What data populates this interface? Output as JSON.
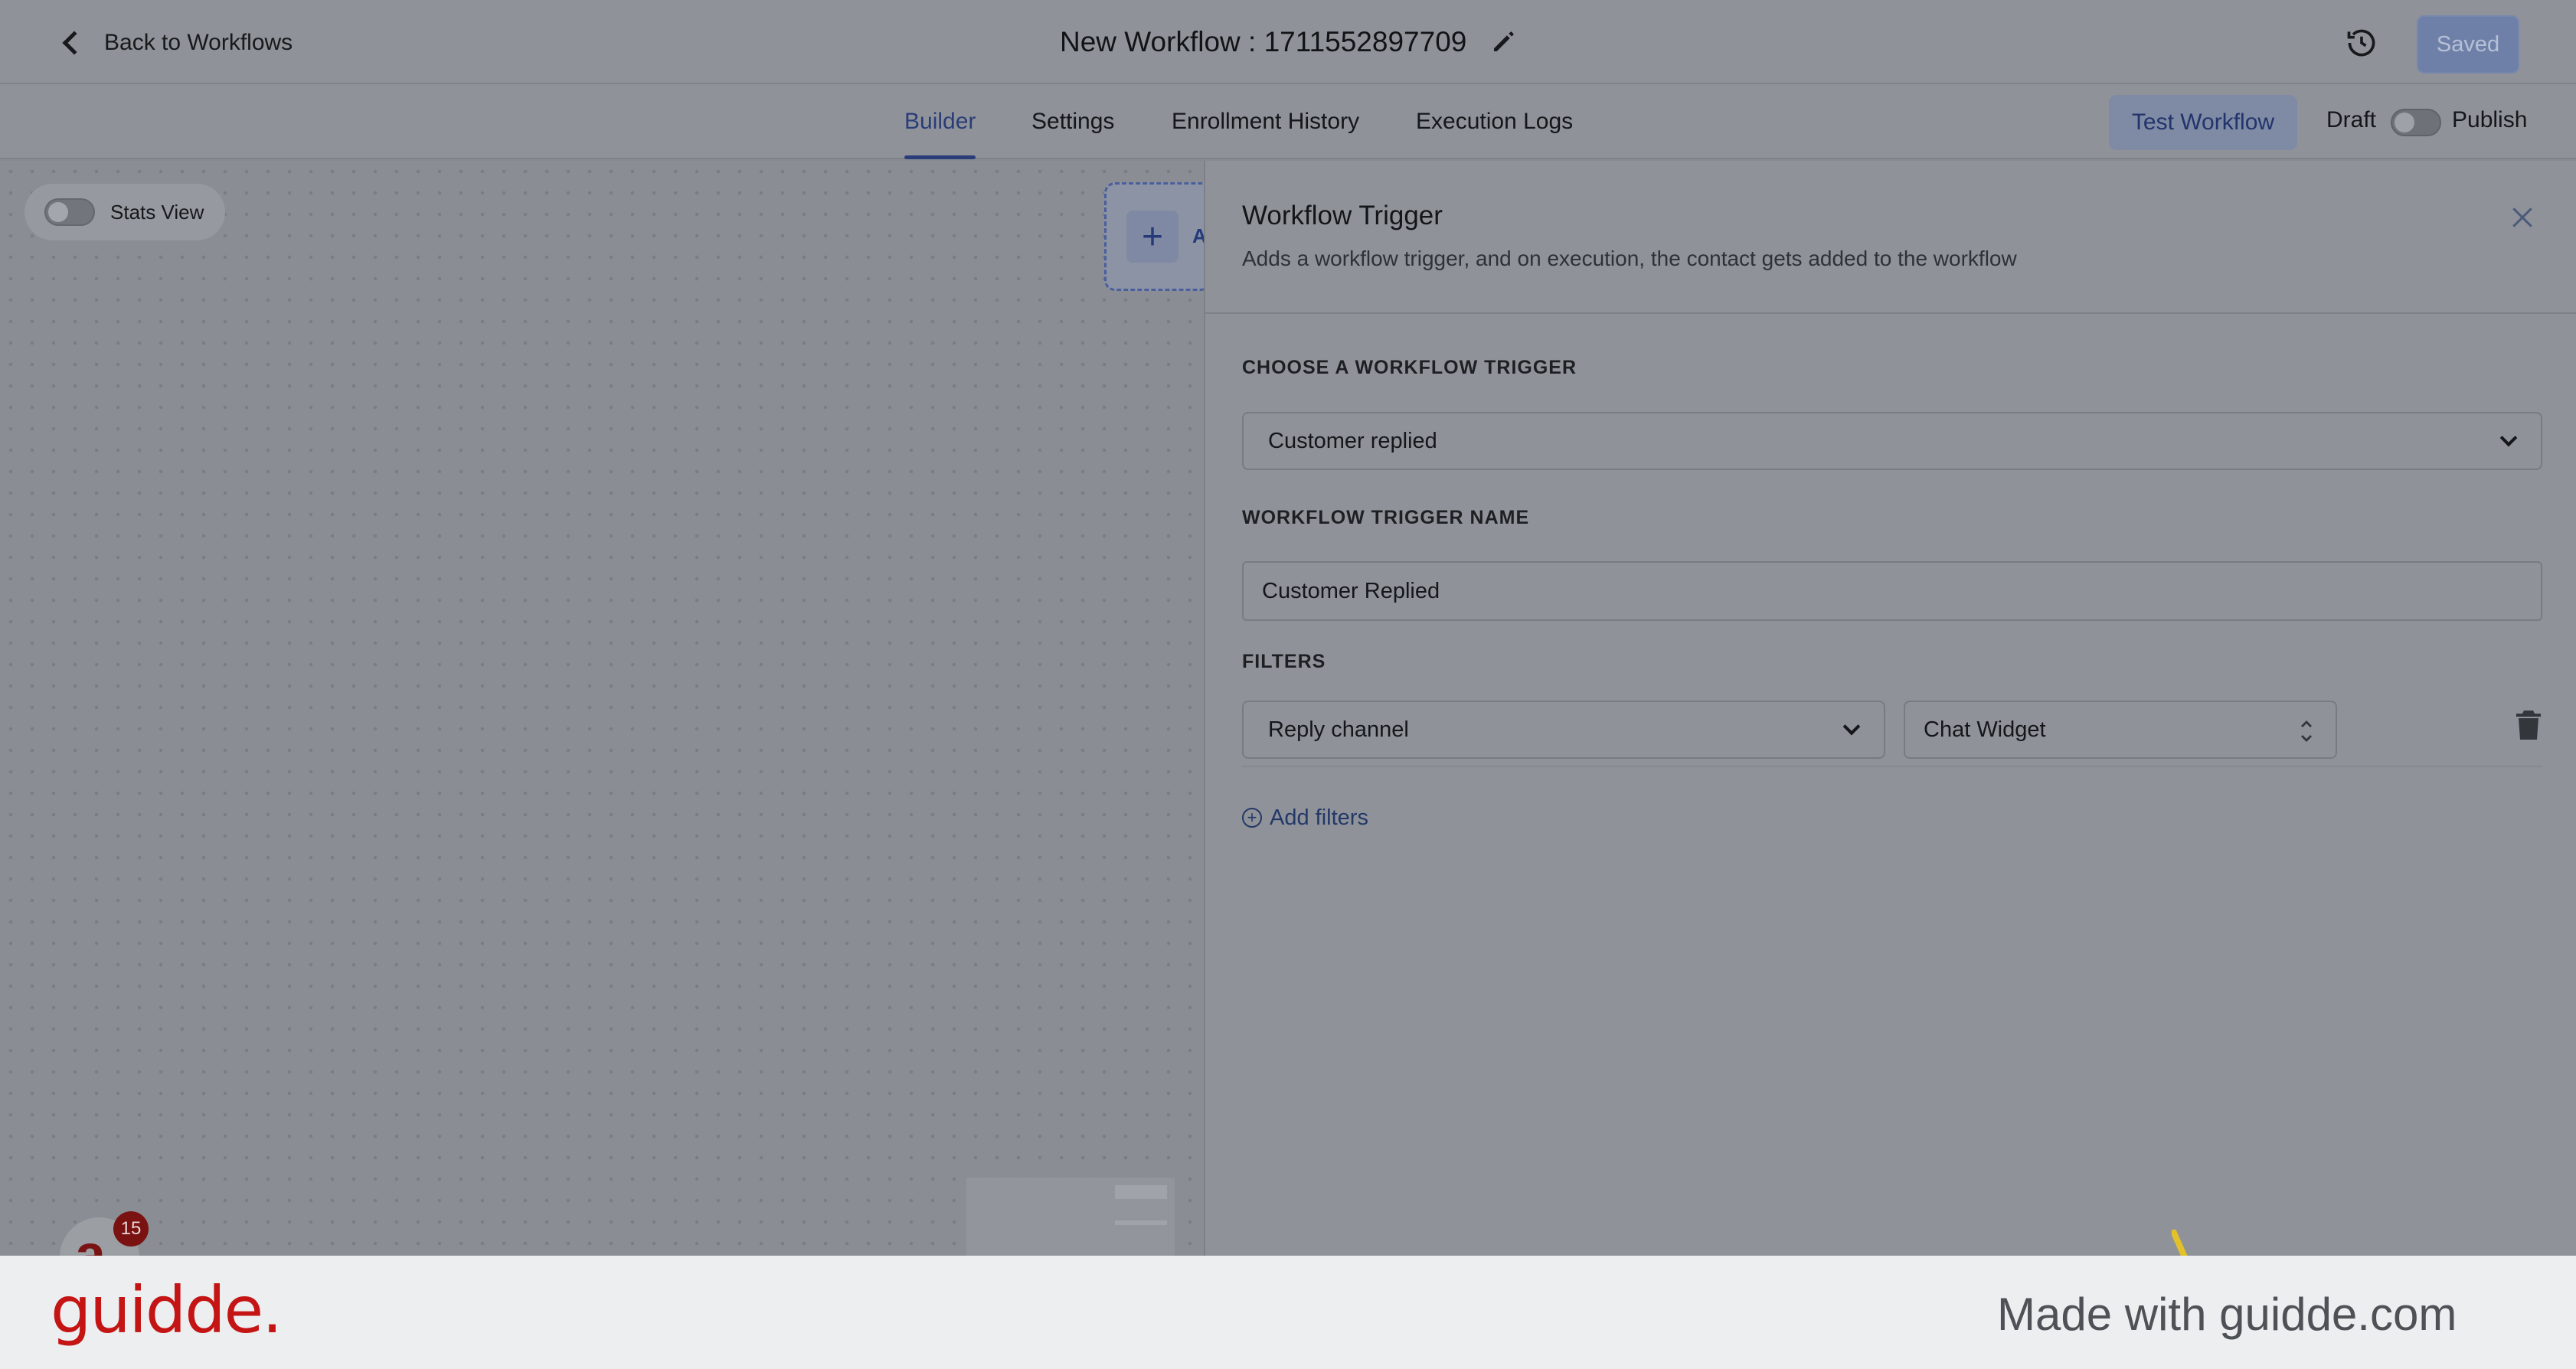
{
  "header": {
    "back_label": "Back to Workflows",
    "title": "New Workflow : 1711552897709",
    "saved_label": "Saved",
    "icons": {
      "back": "chevron-left-icon",
      "edit": "pencil-icon",
      "history": "history-clock-icon"
    }
  },
  "tabs": [
    {
      "label": "Builder",
      "active": true
    },
    {
      "label": "Settings",
      "active": false
    },
    {
      "label": "Enrollment History",
      "active": false
    },
    {
      "label": "Execution Logs",
      "active": false
    }
  ],
  "actions": {
    "test_workflow": "Test Workflow",
    "draft": "Draft",
    "publish": "Publish",
    "publish_toggle_on": false
  },
  "canvas": {
    "stats_view_label": "Stats View",
    "stats_view_on": false,
    "add_trigger_letter": "A",
    "assistant_badge": "15",
    "assistant_letter": "a"
  },
  "drawer": {
    "title": "Workflow Trigger",
    "subtitle": "Adds a workflow trigger, and on execution, the contact gets added to the workflow",
    "choose_label": "CHOOSE A WORKFLOW TRIGGER",
    "trigger_value": "Customer replied",
    "name_label": "WORKFLOW TRIGGER NAME",
    "name_value": "Customer Replied",
    "filters_label": "FILTERS",
    "filter_field": "Reply channel",
    "filter_value": "Chat Widget",
    "add_filters": "Add filters"
  },
  "footer": {
    "brand": "guidde.",
    "made_with": "Made with guidde.com"
  },
  "colors": {
    "accent": "#2a3d78",
    "brand_red": "#c41414"
  }
}
